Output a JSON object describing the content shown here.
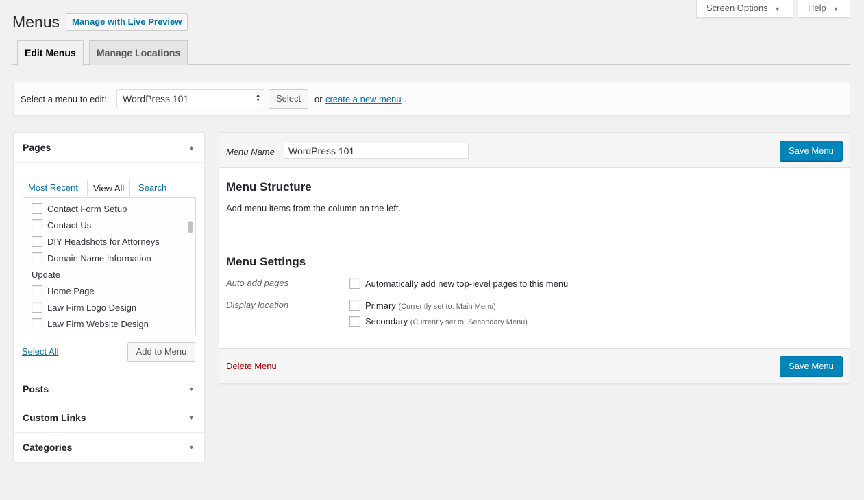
{
  "screen_meta": {
    "screen_options_label": "Screen Options",
    "help_label": "Help"
  },
  "page": {
    "title": "Menus",
    "action_label": "Manage with Live Preview"
  },
  "tabs": [
    {
      "label": "Edit Menus"
    },
    {
      "label": "Manage Locations"
    }
  ],
  "select_menu": {
    "label": "Select a menu to edit:",
    "selected": "WordPress 101",
    "select_button": "Select",
    "or_text": "or",
    "create_link": "create a new menu",
    "period": "."
  },
  "sidebar": {
    "pages_title": "Pages",
    "subtabs": [
      {
        "label": "Most Recent"
      },
      {
        "label": "View All"
      },
      {
        "label": "Search"
      }
    ],
    "items": [
      {
        "label": "Contact Form Setup",
        "checkbox": true
      },
      {
        "label": "Contact Us",
        "checkbox": true
      },
      {
        "label": "DIY Headshots for Attorneys",
        "checkbox": true
      },
      {
        "label": "Domain Name Information",
        "checkbox": true
      },
      {
        "label": "Update",
        "checkbox": false
      },
      {
        "label": "Home Page",
        "checkbox": true
      },
      {
        "label": "Law Firm Logo Design",
        "checkbox": true
      },
      {
        "label": "Law Firm Website Design",
        "checkbox": true
      }
    ],
    "select_all": "Select All",
    "add_to_menu": "Add to Menu",
    "sections": [
      {
        "label": "Posts"
      },
      {
        "label": "Custom Links"
      },
      {
        "label": "Categories"
      }
    ]
  },
  "menu_edit": {
    "menu_name_label": "Menu Name",
    "menu_name_value": "WordPress 101",
    "save_label": "Save Menu",
    "structure_title": "Menu Structure",
    "structure_help": "Add menu items from the column on the left.",
    "settings_title": "Menu Settings",
    "auto_add_label": "Auto add pages",
    "auto_add_option": "Automatically add new top-level pages to this menu",
    "display_location_label": "Display location",
    "locations": [
      {
        "name": "Primary",
        "note": "(Currently set to: Main Menu)"
      },
      {
        "name": "Secondary",
        "note": "(Currently set to: Secondary Menu)"
      }
    ],
    "delete_label": "Delete Menu"
  },
  "colors": {
    "primary_button": "#0085ba",
    "link": "#0073aa",
    "delete": "#a00"
  }
}
